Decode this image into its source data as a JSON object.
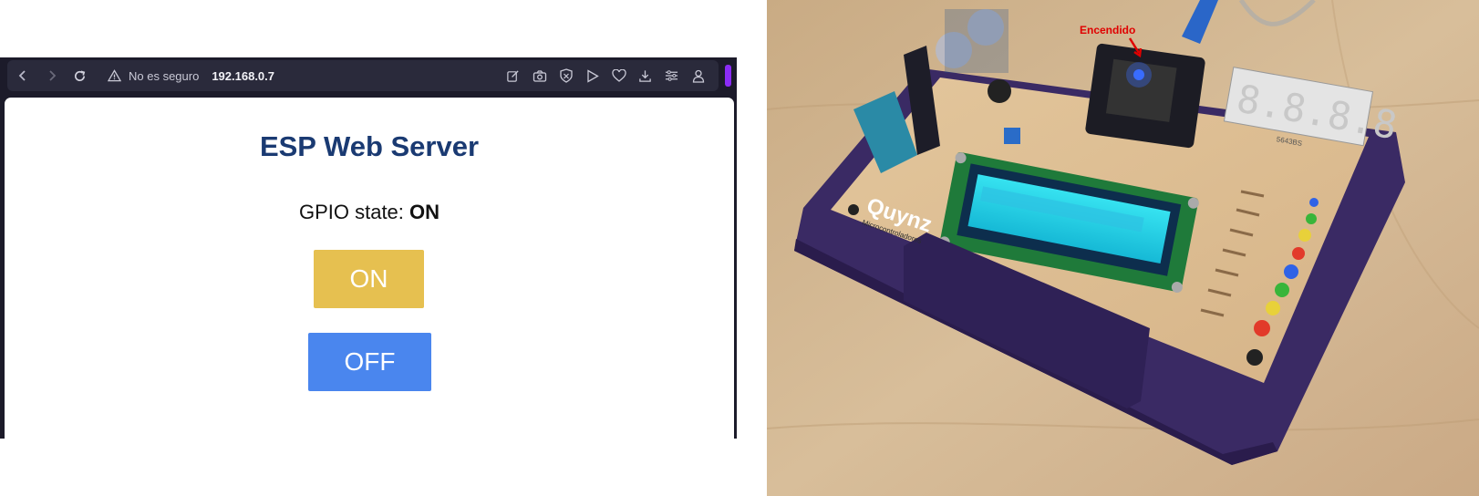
{
  "browser": {
    "security_label": "No es seguro",
    "url": "192.168.0.7",
    "toolbar_icons": [
      "edit-icon",
      "camera-icon",
      "shield-icon",
      "play-icon",
      "heart-icon",
      "download-icon",
      "menu-icon",
      "profile-icon"
    ]
  },
  "page": {
    "title": "ESP Web Server",
    "gpio_label": "GPIO state: ",
    "gpio_value": "ON",
    "on_button": "ON",
    "off_button": "OFF"
  },
  "photo": {
    "annotation": "Encendido",
    "pcb_brand": "Quynz",
    "pcb_subtitle": "Microcontroladores",
    "display_label": "5643BS"
  },
  "colors": {
    "title": "#1a3a72",
    "on_button": "#e6c050",
    "off_button": "#4a86ee",
    "annotation": "#e00000",
    "case": "#3a2a64"
  }
}
